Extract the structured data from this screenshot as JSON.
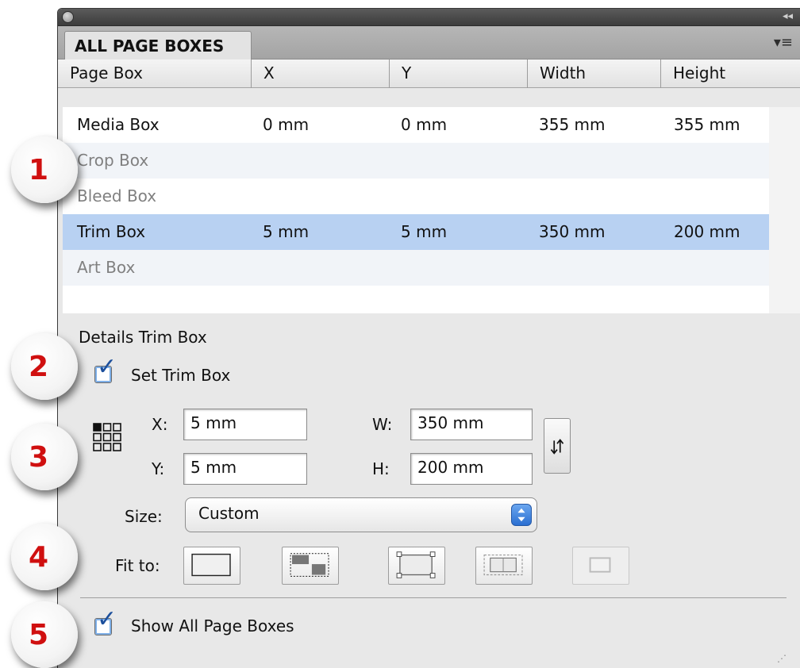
{
  "callouts": [
    "1",
    "2",
    "3",
    "4",
    "5"
  ],
  "panel": {
    "tab_label": "ALL PAGE BOXES",
    "columns": [
      "Page Box",
      "X",
      "Y",
      "Width",
      "Height"
    ],
    "rows": [
      {
        "name": "Media Box",
        "x": "0 mm",
        "y": "0 mm",
        "width": "355 mm",
        "height": "355 mm",
        "state": "enabled"
      },
      {
        "name": "Crop Box",
        "x": "",
        "y": "",
        "width": "",
        "height": "",
        "state": "disabled"
      },
      {
        "name": "Bleed Box",
        "x": "",
        "y": "",
        "width": "",
        "height": "",
        "state": "disabled"
      },
      {
        "name": "Trim Box",
        "x": "5 mm",
        "y": "5 mm",
        "width": "350 mm",
        "height": "200 mm",
        "state": "selected"
      },
      {
        "name": "Art Box",
        "x": "",
        "y": "",
        "width": "",
        "height": "",
        "state": "disabled"
      }
    ]
  },
  "details": {
    "heading": "Details Trim Box",
    "set_checkbox_label": "Set Trim Box",
    "set_checked": true,
    "x_label": "X:",
    "x_value": "5 mm",
    "y_label": "Y:",
    "y_value": "5 mm",
    "w_label": "W:",
    "w_value": "350 mm",
    "h_label": "H:",
    "h_value": "200 mm",
    "size_label": "Size:",
    "size_value": "Custom",
    "fit_label": "Fit to:"
  },
  "footer": {
    "show_all_label": "Show All Page Boxes",
    "show_all_checked": true
  },
  "colors": {
    "selection": "#b8d1f2",
    "callout_number": "#d01010",
    "checkmark": "#1c4f9c"
  }
}
